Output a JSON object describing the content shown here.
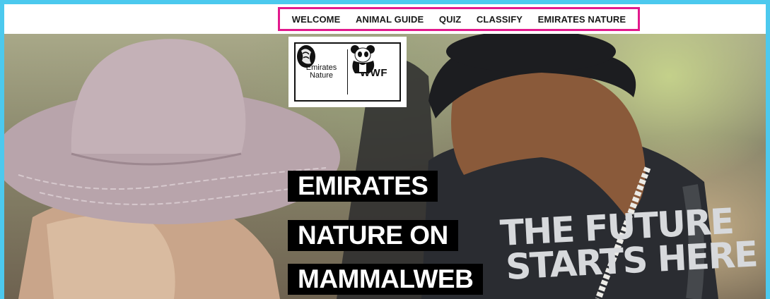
{
  "nav": {
    "items": [
      {
        "label": "WELCOME"
      },
      {
        "label": "ANIMAL GUIDE"
      },
      {
        "label": "QUIZ"
      },
      {
        "label": "CLASSIFY"
      },
      {
        "label": "EMIRATES NATURE"
      }
    ],
    "highlight_color": "#e2198c"
  },
  "logo": {
    "left_text": "Emirates Nature",
    "right_text": "WWF"
  },
  "hero": {
    "title_lines": [
      "EMIRATES",
      "NATURE ON",
      "MAMMALWEB"
    ],
    "shirt_text": [
      "THE FUTURE",
      "STARTS HERE"
    ]
  },
  "colors": {
    "frame": "#4cc9ee",
    "title_bg": "#000000",
    "title_fg": "#ffffff"
  }
}
